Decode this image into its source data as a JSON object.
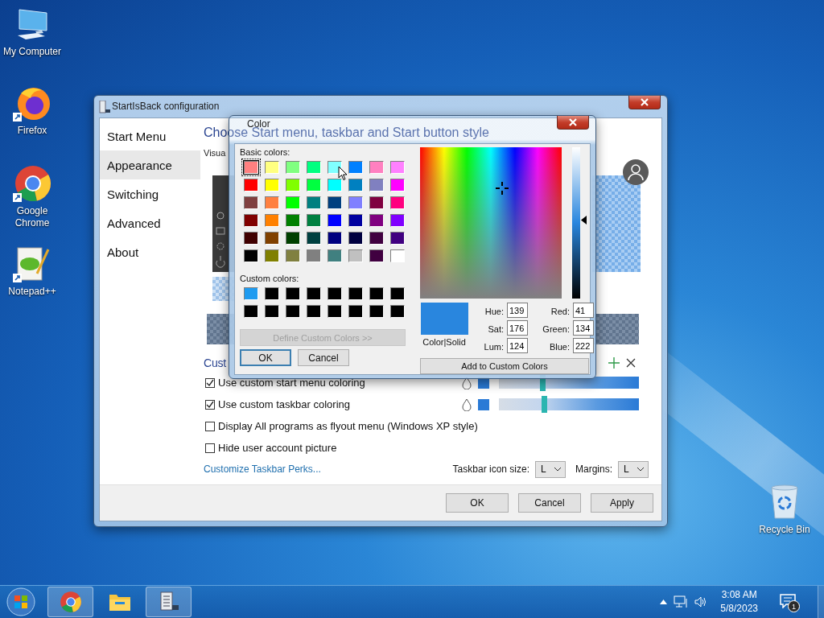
{
  "desktop_icons": [
    {
      "label": "My Computer",
      "kind": "computer"
    },
    {
      "label": "Firefox",
      "kind": "firefox"
    },
    {
      "label": "Google Chrome",
      "kind": "chrome"
    },
    {
      "label": "Notepad++",
      "kind": "notepad"
    },
    {
      "label": "Recycle Bin",
      "kind": "recycle"
    }
  ],
  "config_window": {
    "title": "StartIsBack configuration",
    "nav": [
      {
        "label": "Start Menu",
        "selected": false
      },
      {
        "label": "Appearance",
        "selected": true
      },
      {
        "label": "Switching",
        "selected": false
      },
      {
        "label": "Advanced",
        "selected": false
      },
      {
        "label": "About",
        "selected": false
      }
    ],
    "heading": "Choose Start menu, taskbar and Start button style",
    "subheading": "Visua",
    "section": "Cust",
    "options": [
      {
        "label": "Use custom start menu coloring",
        "checked": true,
        "kind": "color",
        "level": 0.31
      },
      {
        "label": "Use custom taskbar coloring",
        "checked": true,
        "kind": "color",
        "level": 0.32
      },
      {
        "label": "Display All programs as flyout menu (Windows XP style)",
        "checked": false,
        "kind": "plain"
      },
      {
        "label": "Hide user account picture",
        "checked": false,
        "kind": "plain"
      }
    ],
    "link": "Customize Taskbar Perks...",
    "selects": [
      {
        "label": "Taskbar icon size:",
        "value": "L"
      },
      {
        "label": "Margins:",
        "value": "L"
      }
    ],
    "buttons": [
      "OK",
      "Cancel",
      "Apply"
    ]
  },
  "color_dialog": {
    "title": "Color",
    "basic_label": "Basic colors:",
    "basic_colors": [
      {
        "color": "#ff8080",
        "selected": true
      },
      {
        "color": "#ffff80",
        "selected": false
      },
      {
        "color": "#80ff80",
        "selected": false
      },
      {
        "color": "#00ff80",
        "selected": false
      },
      {
        "color": "#80ffff",
        "selected": false
      },
      {
        "color": "#0080ff",
        "selected": false
      },
      {
        "color": "#ff80c0",
        "selected": false
      },
      {
        "color": "#ff80ff",
        "selected": false
      },
      {
        "color": "#ff0000",
        "selected": false
      },
      {
        "color": "#ffff00",
        "selected": false
      },
      {
        "color": "#80ff00",
        "selected": false
      },
      {
        "color": "#00ff40",
        "selected": false
      },
      {
        "color": "#00ffff",
        "selected": false
      },
      {
        "color": "#0080c0",
        "selected": false
      },
      {
        "color": "#8080c0",
        "selected": false
      },
      {
        "color": "#ff00ff",
        "selected": false
      },
      {
        "color": "#804040",
        "selected": false
      },
      {
        "color": "#ff8040",
        "selected": false
      },
      {
        "color": "#00ff00",
        "selected": false
      },
      {
        "color": "#008080",
        "selected": false
      },
      {
        "color": "#004080",
        "selected": false
      },
      {
        "color": "#8080ff",
        "selected": false
      },
      {
        "color": "#800040",
        "selected": false
      },
      {
        "color": "#ff0080",
        "selected": false
      },
      {
        "color": "#800000",
        "selected": false
      },
      {
        "color": "#ff8000",
        "selected": false
      },
      {
        "color": "#008000",
        "selected": false
      },
      {
        "color": "#008040",
        "selected": false
      },
      {
        "color": "#0000ff",
        "selected": false
      },
      {
        "color": "#0000a0",
        "selected": false
      },
      {
        "color": "#800080",
        "selected": false
      },
      {
        "color": "#8000ff",
        "selected": false
      },
      {
        "color": "#400000",
        "selected": false
      },
      {
        "color": "#804000",
        "selected": false
      },
      {
        "color": "#004000",
        "selected": false
      },
      {
        "color": "#004040",
        "selected": false
      },
      {
        "color": "#000080",
        "selected": false
      },
      {
        "color": "#000040",
        "selected": false
      },
      {
        "color": "#400040",
        "selected": false
      },
      {
        "color": "#400080",
        "selected": false
      },
      {
        "color": "#000000",
        "selected": false
      },
      {
        "color": "#808000",
        "selected": false
      },
      {
        "color": "#808040",
        "selected": false
      },
      {
        "color": "#808080",
        "selected": false
      },
      {
        "color": "#408080",
        "selected": false
      },
      {
        "color": "#c0c0c0",
        "selected": false
      },
      {
        "color": "#400040",
        "selected": false
      },
      {
        "color": "#ffffff",
        "selected": false
      }
    ],
    "custom_label": "Custom colors:",
    "custom_colors": [
      {
        "color": "#1e9bf0"
      },
      {
        "color": "#000000"
      },
      {
        "color": "#000000"
      },
      {
        "color": "#000000"
      },
      {
        "color": "#000000"
      },
      {
        "color": "#000000"
      },
      {
        "color": "#000000"
      },
      {
        "color": "#000000"
      },
      {
        "color": "#000000"
      },
      {
        "color": "#000000"
      },
      {
        "color": "#000000"
      },
      {
        "color": "#000000"
      },
      {
        "color": "#000000"
      },
      {
        "color": "#000000"
      },
      {
        "color": "#000000"
      },
      {
        "color": "#000000"
      }
    ],
    "define_button": {
      "label": "Define Custom Colors >>",
      "disabled": true
    },
    "ok": "OK",
    "cancel": "Cancel",
    "preview_label": "Color|Solid",
    "fields": [
      {
        "label": "Hue:",
        "value": "139"
      },
      {
        "label": "Red:",
        "value": "41"
      },
      {
        "label": "Sat:",
        "value": "176"
      },
      {
        "label": "Green:",
        "value": "134"
      },
      {
        "label": "Lum:",
        "value": "124"
      },
      {
        "label": "Blue:",
        "value": "222"
      }
    ],
    "luminosity": {
      "level": 0.52
    },
    "add_button": "Add to Custom Colors"
  },
  "taskbar": {
    "apps": [
      {
        "kind": "chrome",
        "running": true
      },
      {
        "kind": "explorer",
        "running": false
      },
      {
        "kind": "startisback",
        "running": true
      }
    ],
    "time": "3:08 AM",
    "date": "5/8/2023",
    "notification_count": "1"
  }
}
